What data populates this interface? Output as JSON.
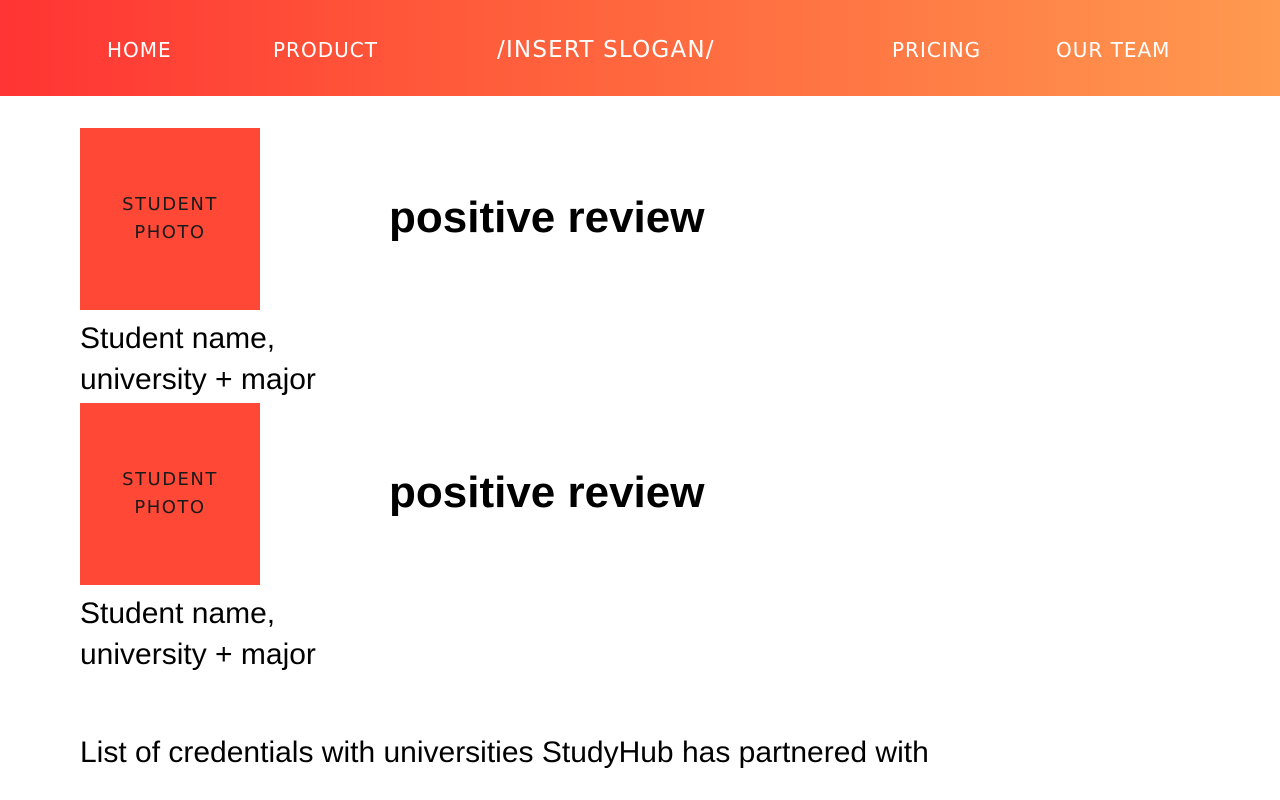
{
  "colors": {
    "header_gradient_start": "#ff3434",
    "header_gradient_end": "#ff9a50",
    "photo_placeholder": "#ff4835",
    "nav_text": "#ffffff"
  },
  "nav": {
    "home": "HOME",
    "product": "PRODUCT",
    "slogan": "/INSERT SLOGAN/",
    "pricing": "PRICING",
    "team": "OUR TEAM"
  },
  "reviews": [
    {
      "photo_label_line1": "STUDENT",
      "photo_label_line2": "PHOTO",
      "review_text": "positive review",
      "caption_line1": "Student name,",
      "caption_line2": "university + major"
    },
    {
      "photo_label_line1": "STUDENT",
      "photo_label_line2": "PHOTO",
      "review_text": "positive review",
      "caption_line1": "Student name,",
      "caption_line2": "university + major"
    }
  ],
  "credentials": "List of credentials with universities StudyHub has partnered with"
}
